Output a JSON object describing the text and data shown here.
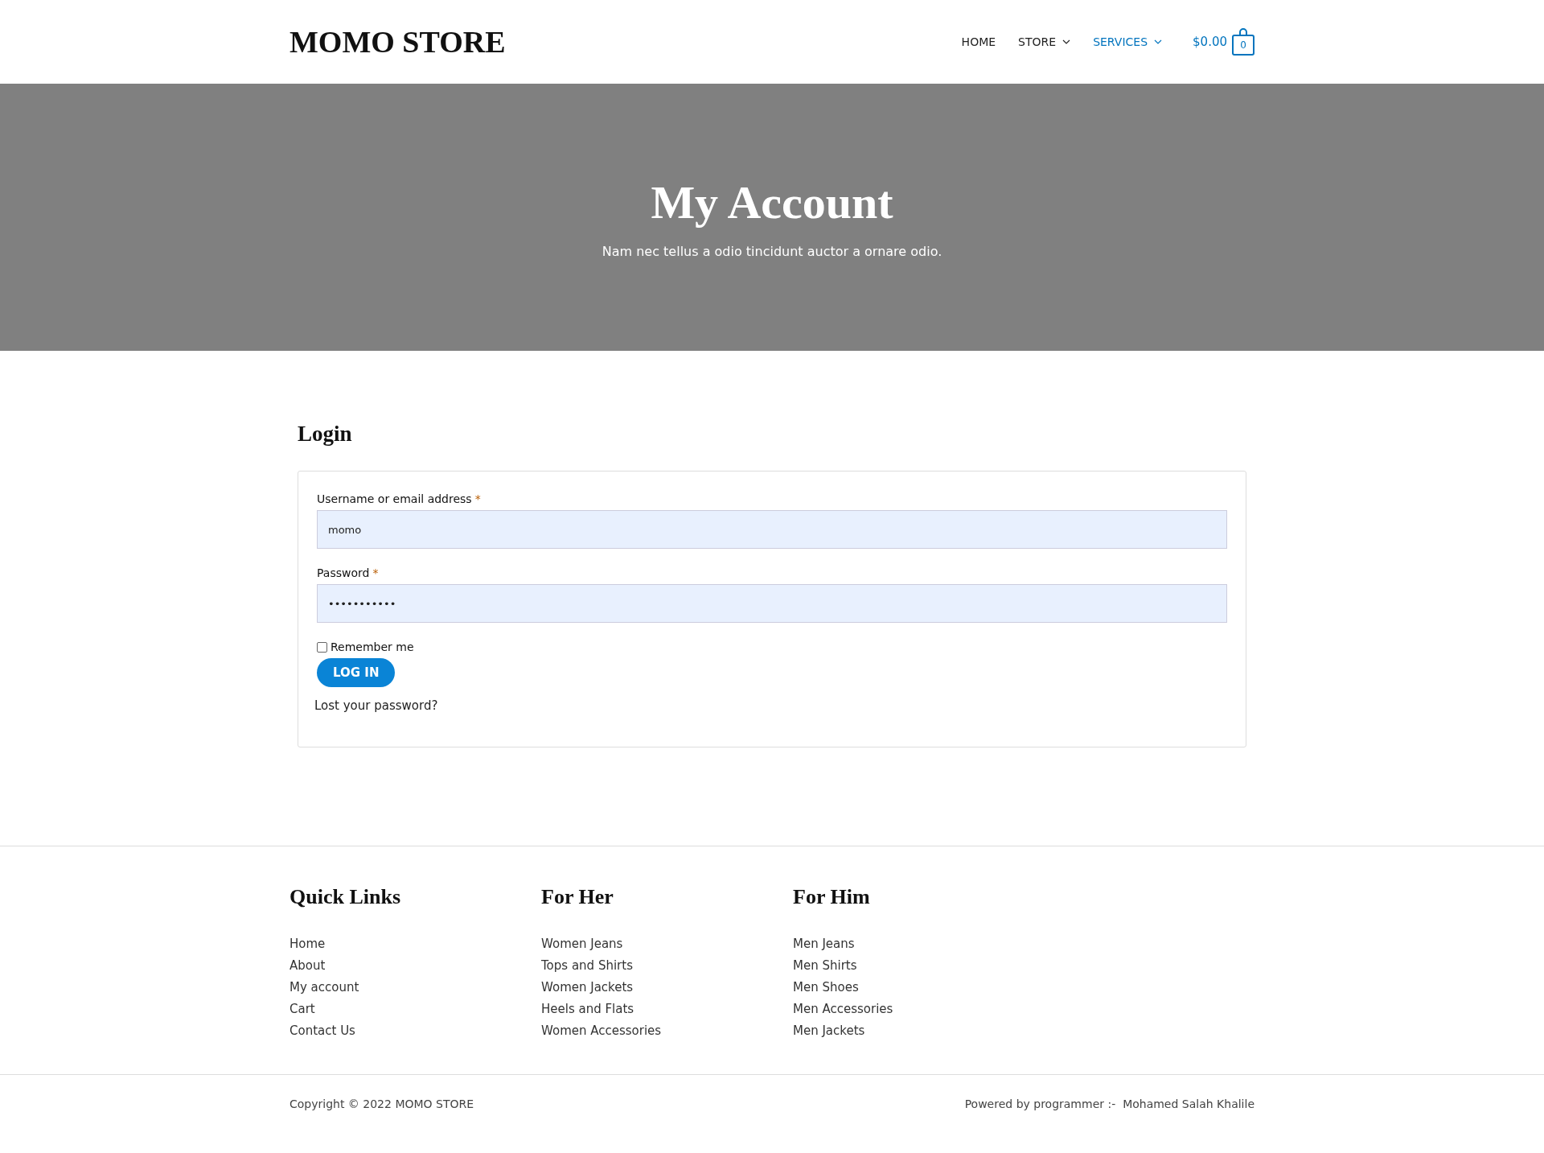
{
  "header": {
    "logo": "MOMO STORE",
    "nav": [
      {
        "label": "HOME",
        "selected": false,
        "dropdown": false
      },
      {
        "label": "STORE",
        "selected": false,
        "dropdown": true
      },
      {
        "label": "SERVICES",
        "selected": true,
        "dropdown": true
      }
    ],
    "cart": {
      "total": "$0.00",
      "count": "0"
    }
  },
  "hero": {
    "title": "My Account",
    "subtitle": "Nam nec tellus a odio tincidunt auctor a ornare odio."
  },
  "login": {
    "heading": "Login",
    "fields": [
      {
        "label": "Username or email address",
        "required_mark": "*",
        "value": "momo"
      },
      {
        "label": "Password",
        "required_mark": "*",
        "value": "•••••••••••"
      }
    ],
    "remember": {
      "label": "Remember me",
      "checked": false
    },
    "button": "LOG IN",
    "lost_password": "Lost your password?"
  },
  "footer": {
    "columns": [
      {
        "heading": "Quick Links",
        "links": [
          "Home",
          "About",
          "My account",
          "Cart",
          "Contact Us"
        ]
      },
      {
        "heading": "For Her",
        "links": [
          "Women Jeans",
          "Tops and Shirts",
          "Women Jackets",
          "Heels and Flats",
          "Women Accessories"
        ]
      },
      {
        "heading": "For Him",
        "links": [
          "Men Jeans",
          "Men Shirts",
          "Men Shoes",
          "Men Accessories",
          "Men Jackets"
        ]
      }
    ],
    "copyright": "Copyright © 2022 MOMO STORE",
    "credit": "Powered by programmer :-  Mohamed Salah Khalile"
  }
}
